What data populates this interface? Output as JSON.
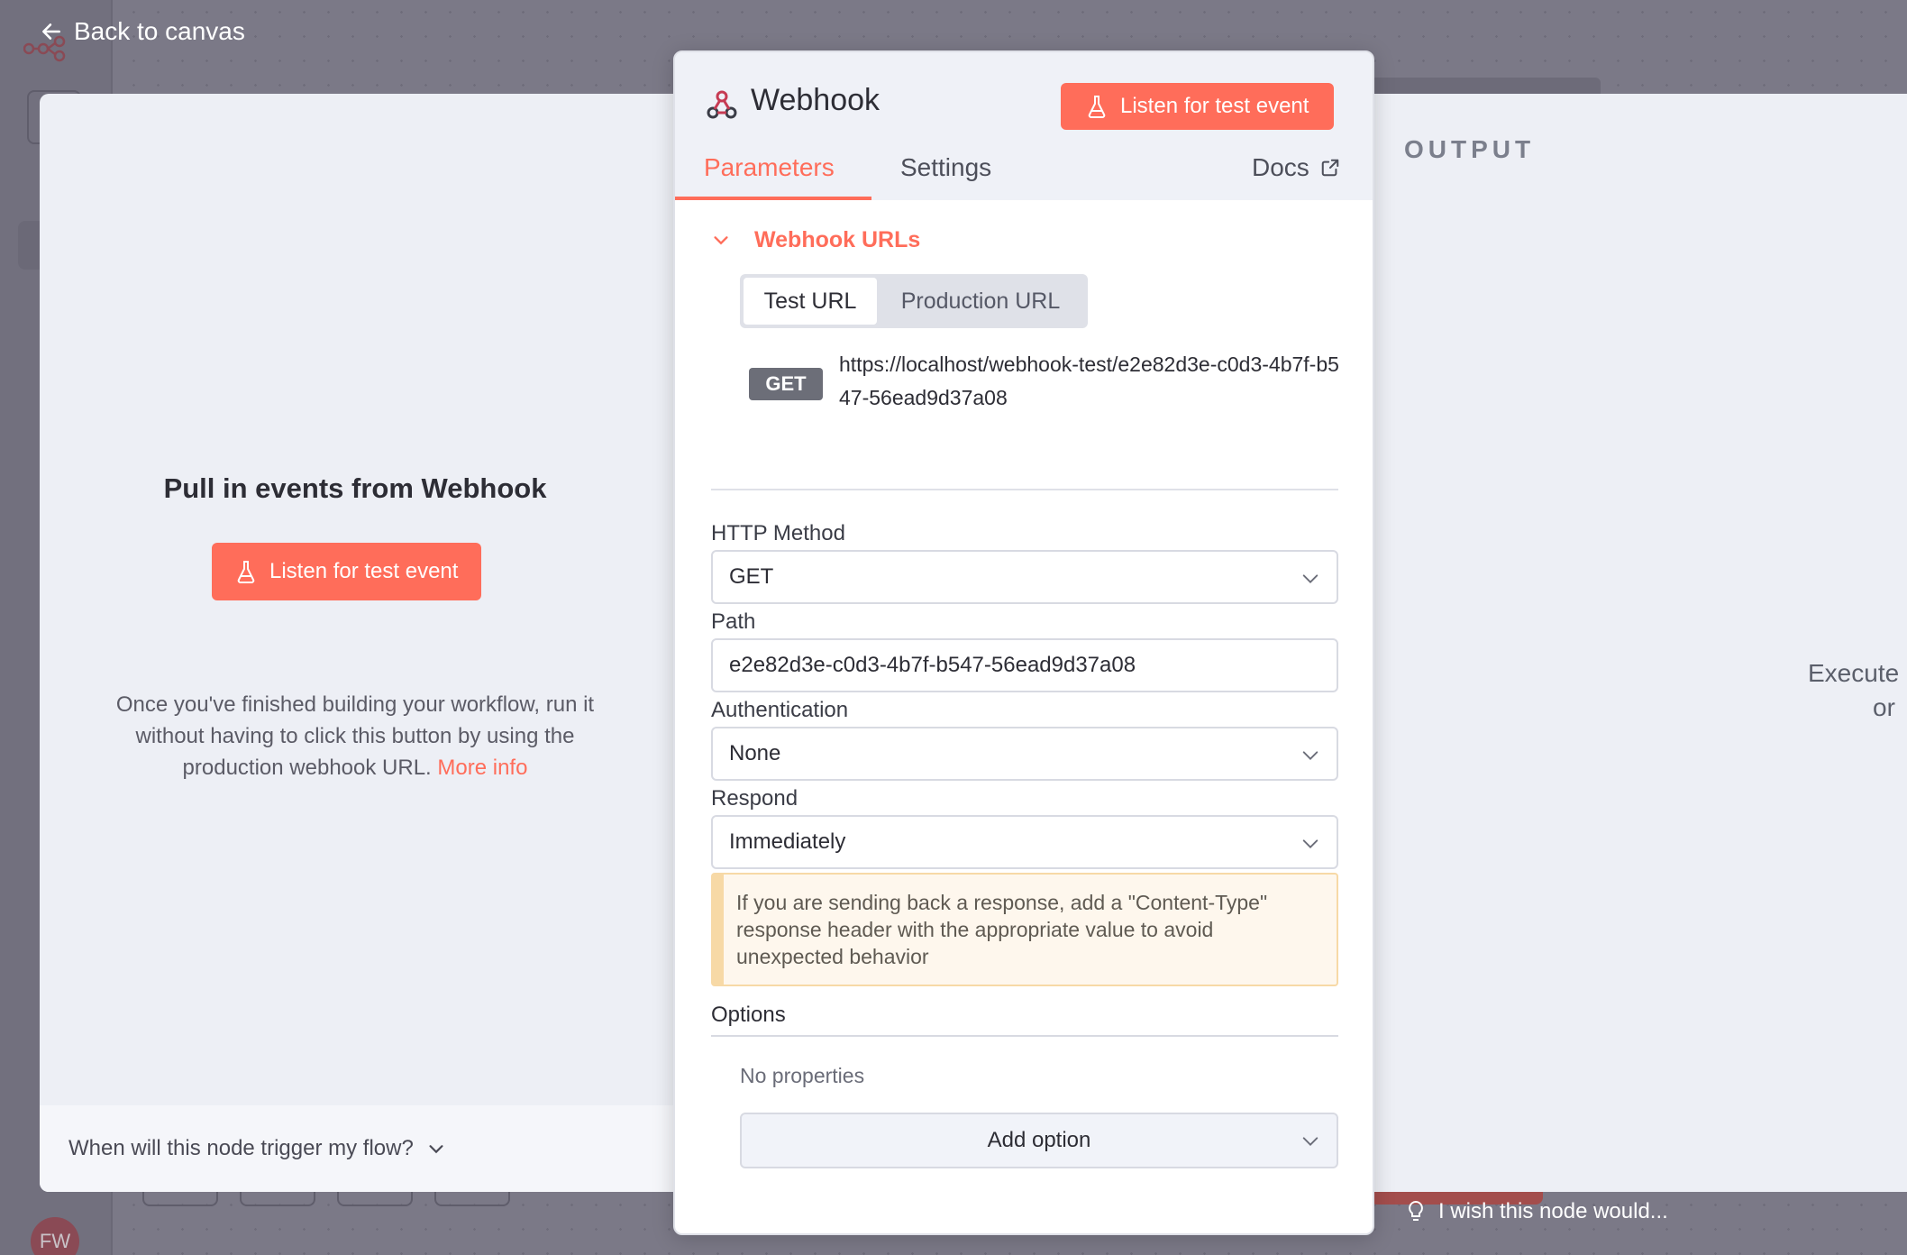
{
  "nav": {
    "back_label": "Back to canvas",
    "avatar_initials": "FW"
  },
  "input_panel": {
    "title": "Pull in events from Webhook",
    "listen_label": "Listen for test event",
    "description": "Once you've finished building your workflow, run it without having to click this button by using the production webhook URL.",
    "more_info": "More info",
    "footer_question": "When will this node trigger my flow?"
  },
  "output_panel": {
    "label": "OUTPUT",
    "execute_line1": "Execute",
    "execute_line2": "or"
  },
  "node": {
    "title": "Webhook",
    "listen_label": "Listen for test event",
    "tabs": {
      "parameters": "Parameters",
      "settings": "Settings",
      "docs": "Docs"
    },
    "webhook_urls": {
      "section_label": "Webhook URLs",
      "test_tab": "Test URL",
      "production_tab": "Production URL",
      "method": "GET",
      "url": "https://localhost/webhook-test/e2e82d3e-c0d3-4b7f-b547-56ead9d37a08"
    },
    "http_method": {
      "label": "HTTP Method",
      "value": "GET"
    },
    "path": {
      "label": "Path",
      "value": "e2e82d3e-c0d3-4b7f-b547-56ead9d37a08"
    },
    "authentication": {
      "label": "Authentication",
      "value": "None"
    },
    "respond": {
      "label": "Respond",
      "value": "Immediately"
    },
    "notice": "If you are sending back a response, add a \"Content-Type\" response header with the appropriate value to avoid unexpected behavior",
    "options": {
      "label": "Options",
      "empty": "No properties",
      "add_label": "Add option"
    }
  },
  "feedback": {
    "wish_label": "I wish this node would..."
  },
  "colors": {
    "accent": "#ff6d5a",
    "notice_border": "#f7d9a6",
    "backdrop": "#7a7886"
  }
}
